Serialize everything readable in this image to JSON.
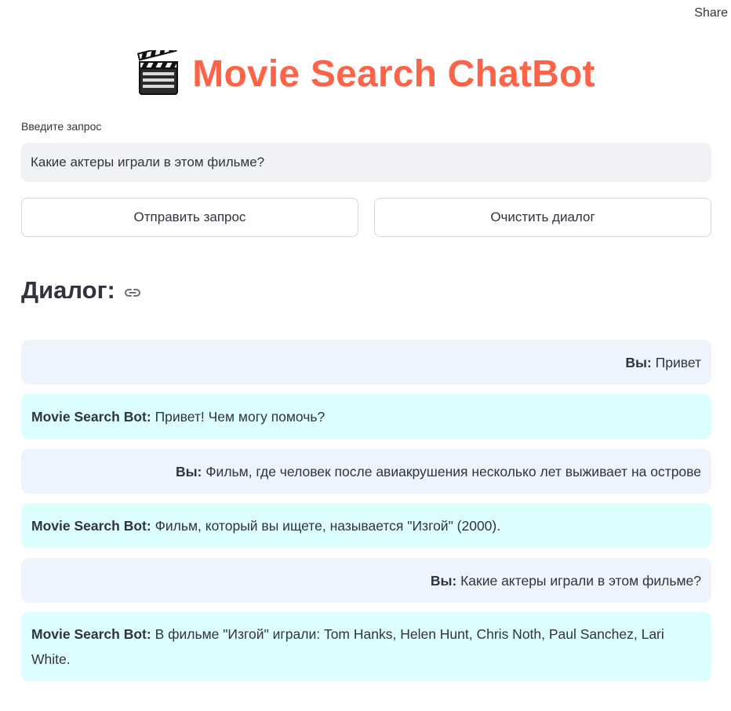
{
  "header": {
    "share_label": "Share"
  },
  "title": {
    "text": "Movie Search ChatBot",
    "icon": "clapper-board-icon",
    "color": "#ff6347"
  },
  "query": {
    "label": "Введите запрос",
    "value": "Какие актеры играли в этом фильме?",
    "placeholder": ""
  },
  "buttons": {
    "send_label": "Отправить запрос",
    "clear_label": "Очистить диалог"
  },
  "dialog": {
    "heading": "Диалог:",
    "link_icon": "link-icon",
    "user_bg": "#edf4fd",
    "bot_bg": "#dcfefe",
    "messages": [
      {
        "role": "user",
        "speaker": "Вы:",
        "text": "Привет"
      },
      {
        "role": "bot",
        "speaker": "Movie Search Bot:",
        "text": "Привет! Чем могу помочь?"
      },
      {
        "role": "user",
        "speaker": "Вы:",
        "text": "Фильм, где человек после авиакрушения несколько лет выживает на острове"
      },
      {
        "role": "bot",
        "speaker": "Movie Search Bot:",
        "text": "Фильм, который вы ищете, называется \"Изгой\" (2000)."
      },
      {
        "role": "user",
        "speaker": "Вы:",
        "text": "Какие актеры играли в этом фильме?"
      },
      {
        "role": "bot",
        "speaker": "Movie Search Bot:",
        "text": "В фильме \"Изгой\" играли: Tom Hanks, Helen Hunt, Chris Noth, Paul Sanchez, Lari White."
      }
    ]
  }
}
